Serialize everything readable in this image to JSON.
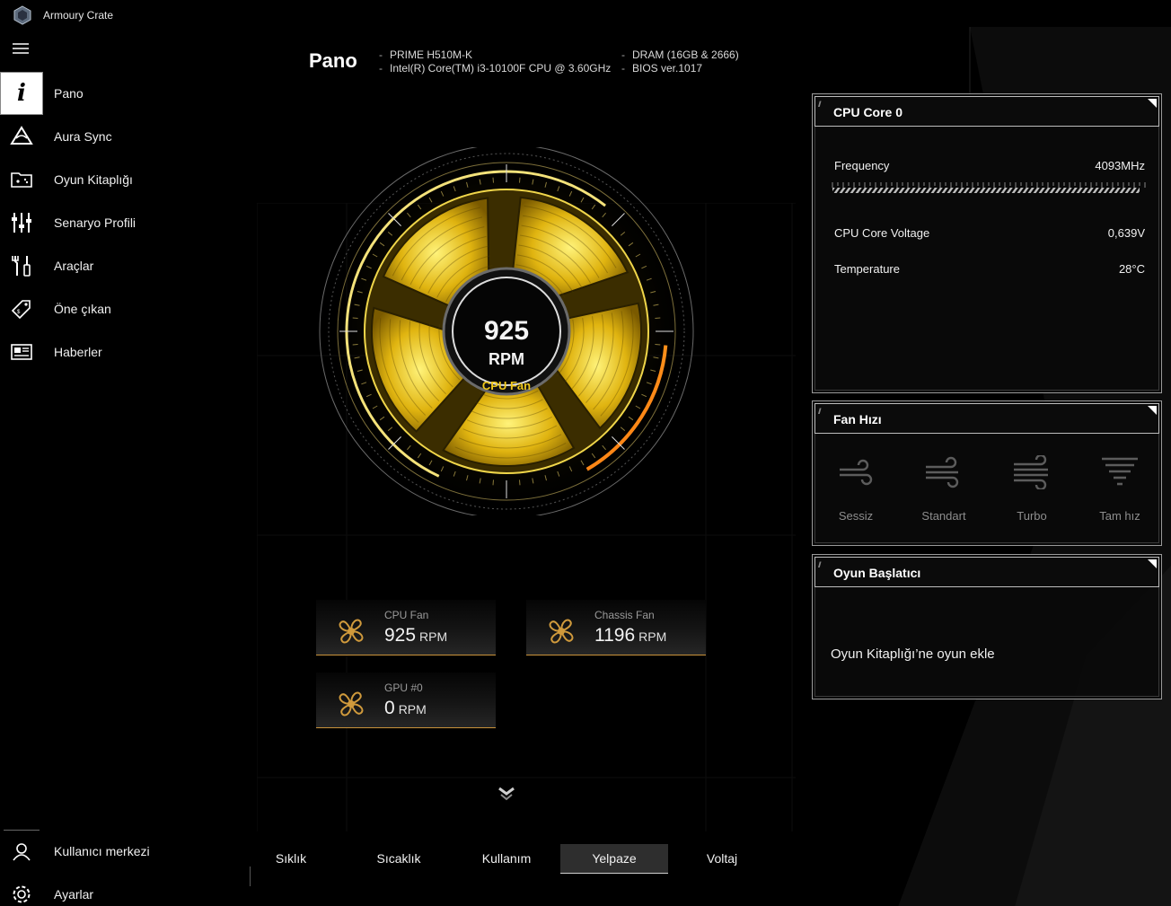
{
  "app": {
    "title": "Armoury Crate"
  },
  "sidebar": {
    "items": [
      {
        "label": "Pano",
        "icon": "info-icon",
        "active": true
      },
      {
        "label": "Aura Sync",
        "icon": "aura-triangle-icon"
      },
      {
        "label": "Oyun Kitaplığı",
        "icon": "game-library-icon"
      },
      {
        "label": "Senaryo Profili",
        "icon": "sliders-icon"
      },
      {
        "label": "Araçlar",
        "icon": "tools-icon"
      },
      {
        "label": "Öne çıkan",
        "icon": "tag-icon"
      },
      {
        "label": "Haberler",
        "icon": "news-icon"
      }
    ],
    "bottom": [
      {
        "label": "Kullanıcı merkezi",
        "icon": "user-icon"
      },
      {
        "label": "Ayarlar",
        "icon": "gear-icon"
      }
    ]
  },
  "header": {
    "title": "Pano",
    "motherboard": "PRIME H510M-K",
    "cpu": "Intel(R) Core(TM) i3-10100F CPU @ 3.60GHz",
    "dram": "DRAM (16GB & 2666)",
    "bios": "BIOS ver.1017"
  },
  "gauge": {
    "value": "925",
    "unit": "RPM",
    "label": "CPU Fan",
    "accent": "#e8c21a",
    "accent_orange": "#ff8a1c"
  },
  "fans": [
    {
      "name": "CPU Fan",
      "value": "925",
      "unit": "RPM"
    },
    {
      "name": "Chassis Fan",
      "value": "1196",
      "unit": "RPM"
    },
    {
      "name": "GPU #0",
      "value": "0",
      "unit": "RPM"
    }
  ],
  "tabs": [
    {
      "label": "Sıklık"
    },
    {
      "label": "Sıcaklık"
    },
    {
      "label": "Kullanım"
    },
    {
      "label": "Yelpaze",
      "active": true
    },
    {
      "label": "Voltaj"
    }
  ],
  "cpu_panel": {
    "title": "CPU Core 0",
    "frequency_label": "Frequency",
    "frequency_value": "4093MHz",
    "voltage_label": "CPU Core Voltage",
    "voltage_value": "0,639V",
    "temp_label": "Temperature",
    "temp_value": "28°C"
  },
  "fan_panel": {
    "title": "Fan Hızı",
    "modes": [
      {
        "label": "Sessiz",
        "icon": "wind-silent-icon"
      },
      {
        "label": "Standart",
        "icon": "wind-standard-icon"
      },
      {
        "label": "Turbo",
        "icon": "wind-turbo-icon"
      },
      {
        "label": "Tam hız",
        "icon": "full-speed-icon"
      }
    ]
  },
  "launcher_panel": {
    "title": "Oyun Başlatıcı",
    "add_text": "Oyun Kitaplığı’ne oyun ekle"
  }
}
